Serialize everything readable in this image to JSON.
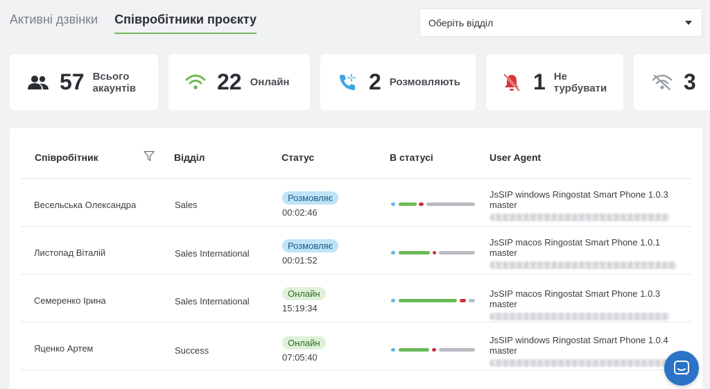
{
  "tabs": [
    {
      "label": "Активні дзвінки",
      "active": false
    },
    {
      "label": "Співробітники проєкту",
      "active": true
    }
  ],
  "department_select": {
    "placeholder": "Оберіть відділ"
  },
  "stats": [
    {
      "icon": "people-icon",
      "count": "57",
      "label_line1": "Всього",
      "label_line2": "акаунтів",
      "color": "#2b2e33"
    },
    {
      "icon": "wifi-icon",
      "count": "22",
      "label_line1": "Онлайн",
      "label_line2": "",
      "color": "#6cba57"
    },
    {
      "icon": "phone-ringing-icon",
      "count": "2",
      "label_line1": "Розмовляють",
      "label_line2": "",
      "color": "#3aa7e3"
    },
    {
      "icon": "bell-off-icon",
      "count": "1",
      "label_line1": "Не",
      "label_line2": "турбувати",
      "color": "#d9363e"
    },
    {
      "icon": "wifi-off-icon",
      "count": "3",
      "label_line1": "",
      "label_line2": "",
      "color": "#9aa0a6"
    }
  ],
  "table": {
    "columns": [
      "Співробітник",
      "Відділ",
      "Статус",
      "В статусі",
      "User Agent"
    ],
    "rows": [
      {
        "name": "Весельська Олександра",
        "department": "Sales",
        "status": "Розмовляє",
        "status_type": "talk",
        "duration": "00:02:46",
        "user_agent": "JsSIP windows Ringostat Smart Phone 1.0.3 master"
      },
      {
        "name": "Листопад Віталій",
        "department": "Sales International",
        "status": "Розмовляє",
        "status_type": "talk",
        "duration": "00:01:52",
        "user_agent": "JsSIP macos Ringostat Smart Phone 1.0.1 master"
      },
      {
        "name": "Семеренко Ірина",
        "department": "Sales International",
        "status": "Онлайн",
        "status_type": "online",
        "duration": "15:19:34",
        "user_agent": "JsSIP macos Ringostat Smart Phone 1.0.3 master"
      },
      {
        "name": "Яценко Артем",
        "department": "Success",
        "status": "Онлайн",
        "status_type": "online",
        "duration": "07:05:40",
        "user_agent": "JsSIP windows Ringostat Smart Phone 1.0.4 master"
      }
    ]
  },
  "colors": {
    "accent": "#6cba57",
    "talk": "#3aa7e3",
    "busy": "#d9363e",
    "idle": "#b8bcc2",
    "chat": "#2a73c6"
  }
}
